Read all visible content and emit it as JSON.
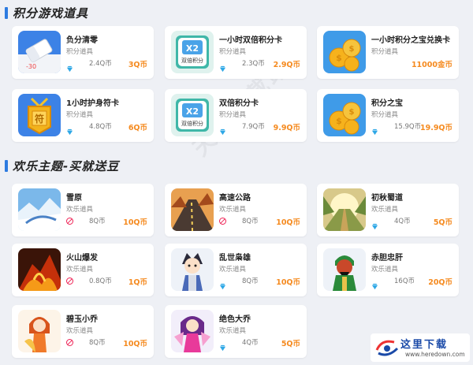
{
  "sections": [
    {
      "title": "积分游戏道具"
    },
    {
      "title": "欢乐主题-买就送豆"
    }
  ],
  "cards": [
    {
      "name": "负分清零",
      "category": "积分道具",
      "original": "2.4Q币",
      "price": "3Q币",
      "icon": "eraser-icon",
      "currency": "diamond"
    },
    {
      "name": "一小时双倍积分卡",
      "category": "积分道具",
      "original": "2.3Q币",
      "price": "2.9Q币",
      "icon": "double-score-card-icon",
      "thumb_text": "X2",
      "thumb_caption": "双倍积分",
      "currency": "diamond"
    },
    {
      "name": "一小时积分之宝兑换卡",
      "category": "积分道具",
      "original": "",
      "price": "11000金币",
      "icon": "gold-coins-icon",
      "currency": "none"
    },
    {
      "name": "1小时护身符卡",
      "category": "积分道具",
      "original": "4.8Q币",
      "price": "6Q币",
      "icon": "amulet-icon",
      "thumb_text": "符",
      "currency": "diamond"
    },
    {
      "name": "双倍积分卡",
      "category": "积分道具",
      "original": "7.9Q币",
      "price": "9.9Q币",
      "icon": "double-score-card-icon",
      "thumb_text": "X2",
      "thumb_caption": "双倍积分",
      "currency": "diamond"
    },
    {
      "name": "积分之宝",
      "category": "积分道具",
      "original": "15.9Q币",
      "price": "19.9Q币",
      "icon": "gold-coins-icon",
      "currency": "diamond"
    },
    {
      "name": "雪原",
      "category": "欢乐道具",
      "original": "8Q币",
      "price": "10Q币",
      "icon": "snowfield-theme-icon",
      "currency": "banned"
    },
    {
      "name": "高速公路",
      "category": "欢乐道具",
      "original": "8Q币",
      "price": "10Q币",
      "icon": "highway-theme-icon",
      "currency": "banned"
    },
    {
      "name": "初秋蜀道",
      "category": "欢乐道具",
      "original": "4Q币",
      "price": "5Q币",
      "icon": "autumn-road-theme-icon",
      "currency": "diamond"
    },
    {
      "name": "火山爆发",
      "category": "欢乐道具",
      "original": "0.8Q币",
      "price": "1Q币",
      "icon": "volcano-theme-icon",
      "currency": "banned"
    },
    {
      "name": "乱世枭雄",
      "category": "欢乐道具",
      "original": "8Q币",
      "price": "10Q币",
      "icon": "warlord-avatar-icon",
      "currency": "diamond"
    },
    {
      "name": "赤胆忠肝",
      "category": "欢乐道具",
      "original": "16Q币",
      "price": "20Q币",
      "icon": "loyal-general-avatar-icon",
      "currency": "diamond"
    },
    {
      "name": "碧玉小乔",
      "category": "欢乐道具",
      "original": "8Q币",
      "price": "10Q币",
      "icon": "xiaoqiao-avatar-icon",
      "currency": "banned"
    },
    {
      "name": "绝色大乔",
      "category": "欢乐道具",
      "original": "4Q币",
      "price": "5Q币",
      "icon": "daqiao-avatar-icon",
      "currency": "diamond"
    }
  ],
  "watermark": "天极下载站",
  "brand": {
    "title": "这里下载",
    "url": "www.heredown.com"
  },
  "colors": {
    "accent": "#2d7be0",
    "price": "#f58a1f",
    "gem": "#2fa8e6",
    "section_bar": "#2d7be0"
  }
}
